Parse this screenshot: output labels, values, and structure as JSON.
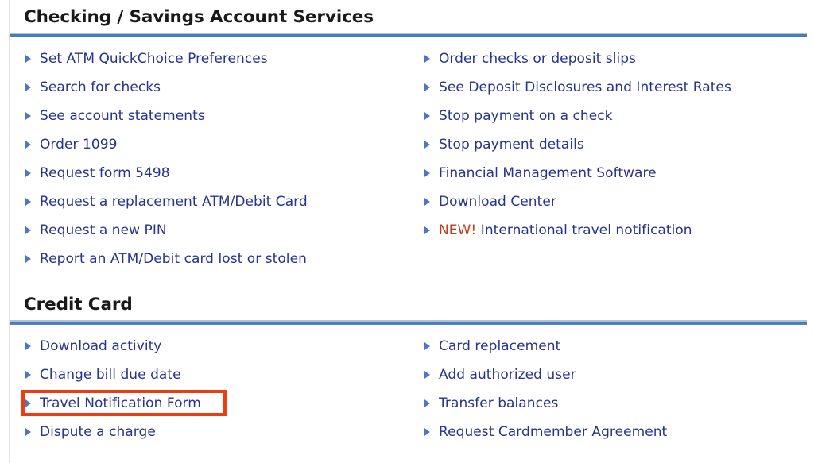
{
  "colors": {
    "heading": "#19191c",
    "link": "#26338f",
    "bullet": "#4f76c0",
    "rule": "#4a7cba",
    "rule_highlight": "#aac4de",
    "highlight_box": "#ee3c12",
    "new_tag": "#c0401e",
    "background": "#ffffff"
  },
  "sections": [
    {
      "id": "checking-savings",
      "title": "Checking / Savings Account Services",
      "left_links": [
        {
          "label": "Set ATM QuickChoice Preferences"
        },
        {
          "label": "Search for checks"
        },
        {
          "label": "See account statements"
        },
        {
          "label": "Order 1099"
        },
        {
          "label": "Request form 5498"
        },
        {
          "label": "Request a replacement ATM/Debit Card"
        },
        {
          "label": "Request a new PIN"
        },
        {
          "label": "Report an ATM/Debit card lost or stolen"
        }
      ],
      "right_links": [
        {
          "label": "Order checks or deposit slips"
        },
        {
          "label": "See Deposit Disclosures and Interest Rates"
        },
        {
          "label": "Stop payment on a check"
        },
        {
          "label": "Stop payment details"
        },
        {
          "label": "Financial Management Software"
        },
        {
          "label": "Download Center"
        },
        {
          "tag": "NEW!",
          "label": "International travel notification"
        }
      ]
    },
    {
      "id": "credit-card",
      "title": "Credit Card",
      "left_links": [
        {
          "label": "Download activity"
        },
        {
          "label": "Change bill due date"
        },
        {
          "label": "Travel Notification Form",
          "highlighted": true
        },
        {
          "label": "Dispute a charge"
        }
      ],
      "right_links": [
        {
          "label": "Card replacement"
        },
        {
          "label": "Add authorized user"
        },
        {
          "label": "Transfer balances"
        },
        {
          "label": "Request Cardmember Agreement"
        }
      ]
    }
  ]
}
